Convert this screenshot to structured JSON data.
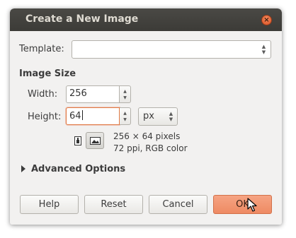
{
  "window": {
    "title": "Create a New Image",
    "close_glyph": "×"
  },
  "template": {
    "label": "Template:",
    "value": "",
    "updown_up": "▲",
    "updown_down": "▼"
  },
  "image_size": {
    "heading": "Image Size",
    "width_label": "Width:",
    "width_value": "256",
    "height_label": "Height:",
    "height_value": "64",
    "unit": "px",
    "info_line1": "256 × 64 pixels",
    "info_line2": "72 ppi, RGB color"
  },
  "advanced": {
    "label": "Advanced Options",
    "expanded": false
  },
  "buttons": {
    "help": "Help",
    "reset": "Reset",
    "cancel": "Cancel",
    "ok": "OK"
  },
  "colors": {
    "titlebar": "#3c3b37",
    "accent": "#ee8a63",
    "dialog_bg": "#f2f1f0"
  }
}
